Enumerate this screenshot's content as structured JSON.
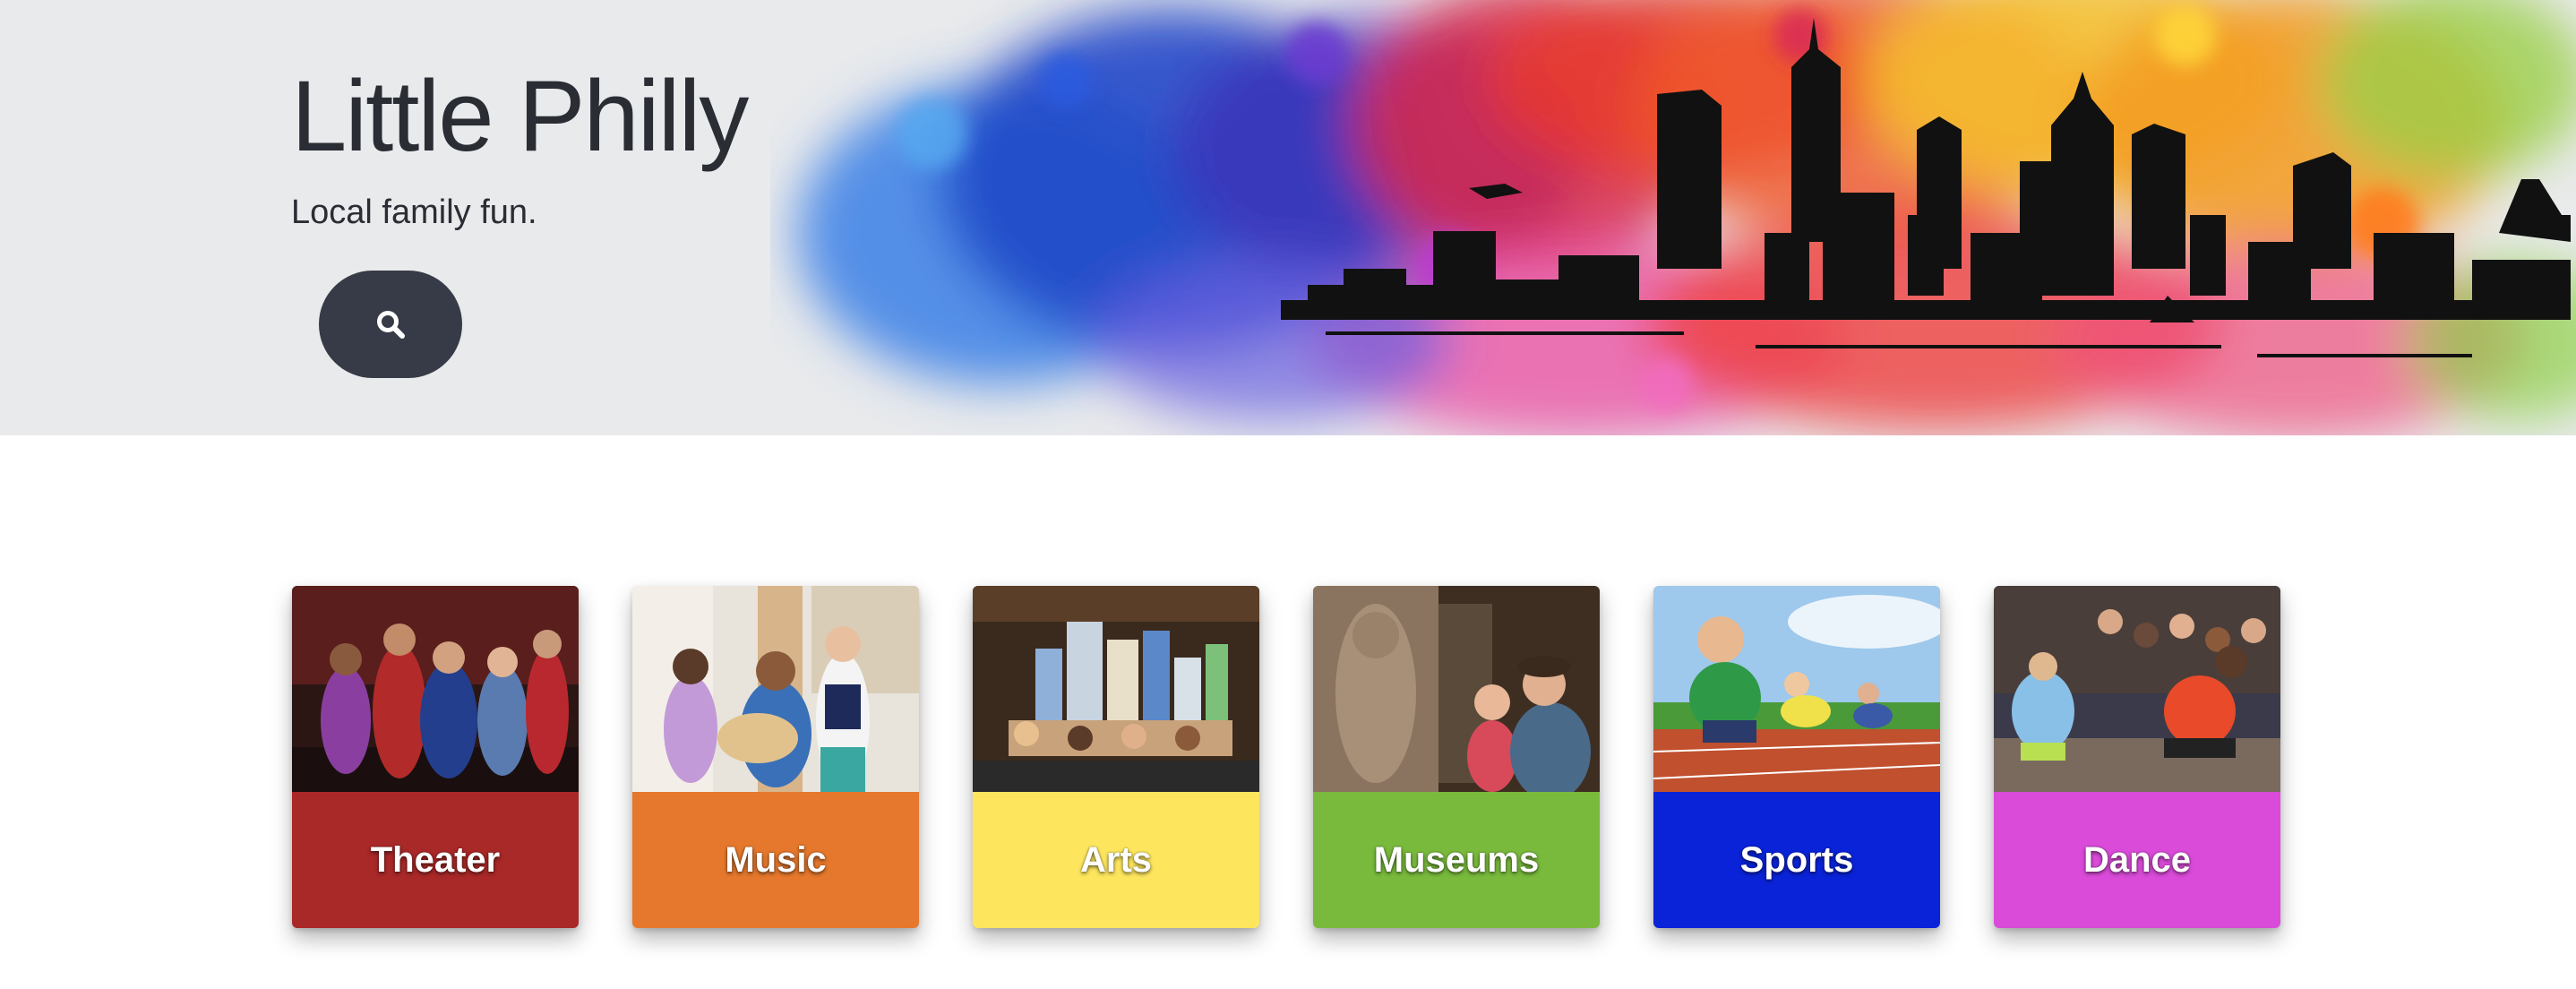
{
  "hero": {
    "title": "Little Philly",
    "tagline": "Local family fun.",
    "search_icon": "search-icon",
    "background": "#e9eaec",
    "button_color": "#363b47"
  },
  "categories": [
    {
      "label": "Theater",
      "color": "#a92828",
      "icon": "theater-photo"
    },
    {
      "label": "Music",
      "color": "#e5782c",
      "icon": "music-photo"
    },
    {
      "label": "Arts",
      "color": "#fde65e",
      "icon": "arts-photo"
    },
    {
      "label": "Museums",
      "color": "#79ba3c",
      "icon": "museums-photo"
    },
    {
      "label": "Sports",
      "color": "#0a23d8",
      "icon": "sports-photo"
    },
    {
      "label": "Dance",
      "color": "#d94bd8",
      "icon": "dance-photo"
    }
  ]
}
